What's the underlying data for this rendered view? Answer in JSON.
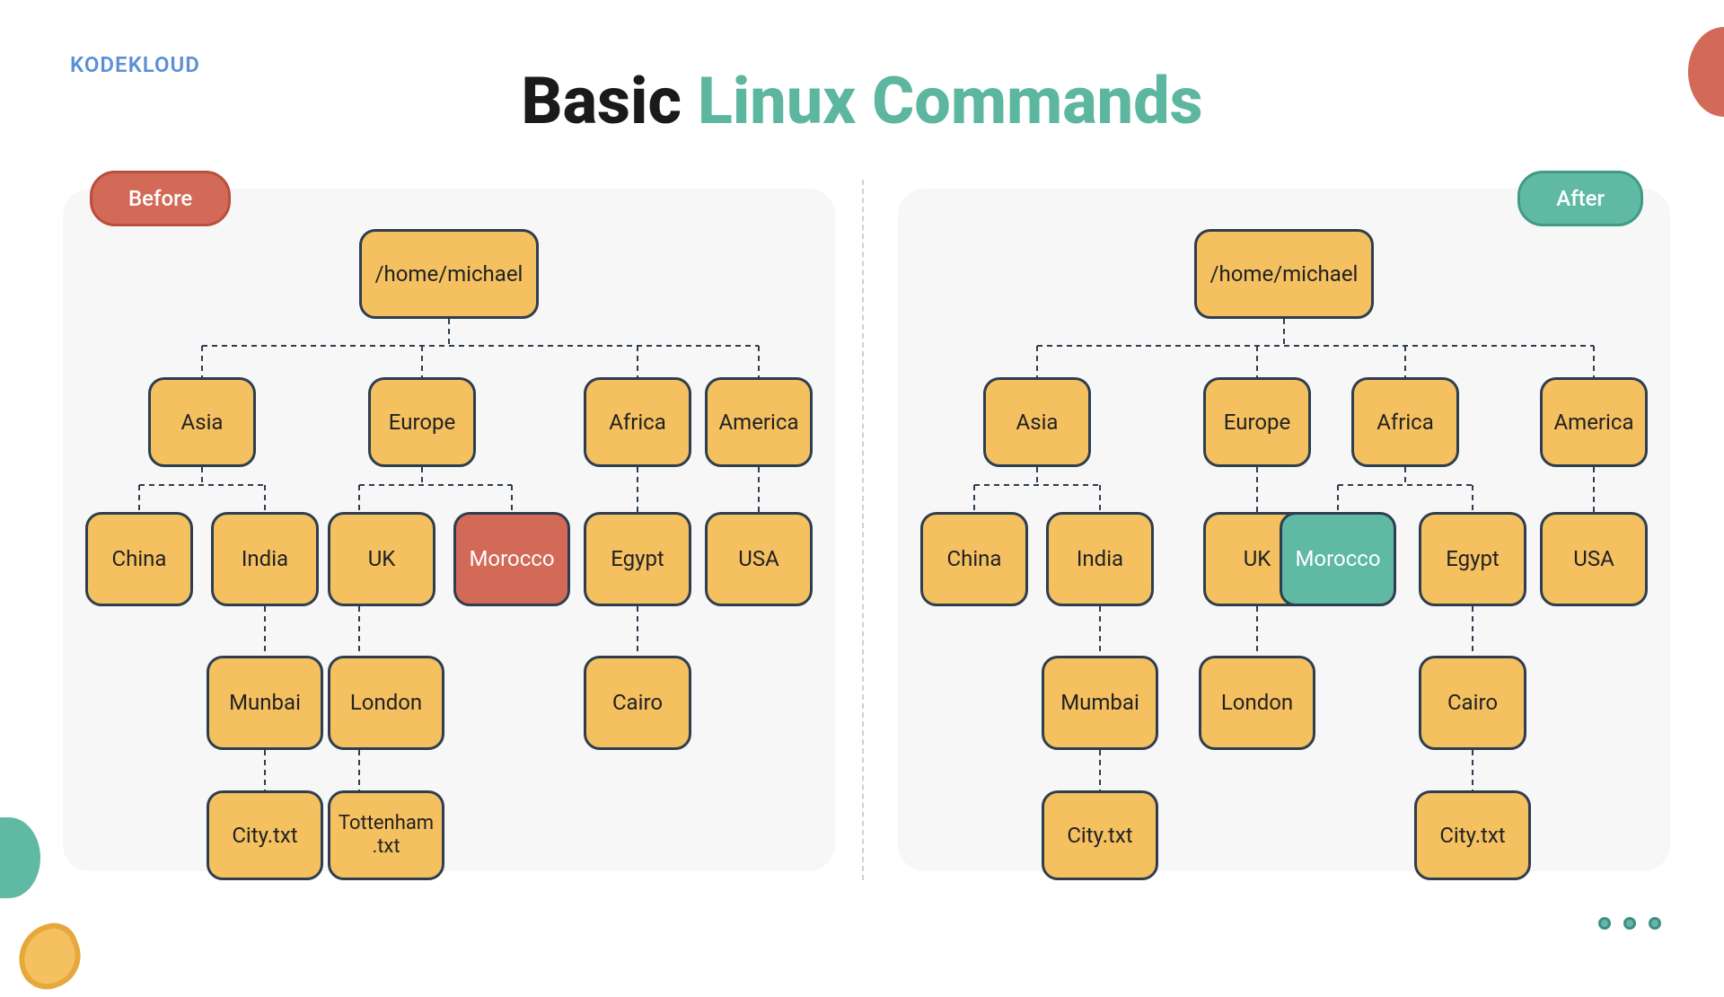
{
  "logo": "KODEKLOUD",
  "title": {
    "part1": "Basic ",
    "part2": "Linux Commands"
  },
  "badges": {
    "before": "Before",
    "after": "After"
  },
  "before": {
    "root": "/home/michael",
    "continents": {
      "asia": "Asia",
      "europe": "Europe",
      "africa": "Africa",
      "america": "America"
    },
    "countries": {
      "china": "China",
      "india": "India",
      "uk": "UK",
      "morocco": "Morocco",
      "egypt": "Egypt",
      "usa": "USA"
    },
    "cities": {
      "munbai": "Munbai",
      "london": "London",
      "cairo": "Cairo"
    },
    "files": {
      "city_txt": "City.txt",
      "tottenham": "Tottenham\n.txt"
    }
  },
  "after": {
    "root": "/home/michael",
    "continents": {
      "asia": "Asia",
      "europe": "Europe",
      "africa": "Africa",
      "america": "America"
    },
    "countries": {
      "china": "China",
      "india": "India",
      "uk": "UK",
      "morocco": "Morocco",
      "egypt": "Egypt",
      "usa": "USA"
    },
    "cities": {
      "mumbai": "Mumbai",
      "london": "London",
      "cairo": "Cairo"
    },
    "files": {
      "city_txt1": "City.txt",
      "city_txt2": "City.txt"
    }
  },
  "colors": {
    "node_fill": "#f4c060",
    "node_border": "#2d3e50",
    "red": "#d36a57",
    "teal": "#60b9a3",
    "panel": "#f7f7f7"
  }
}
